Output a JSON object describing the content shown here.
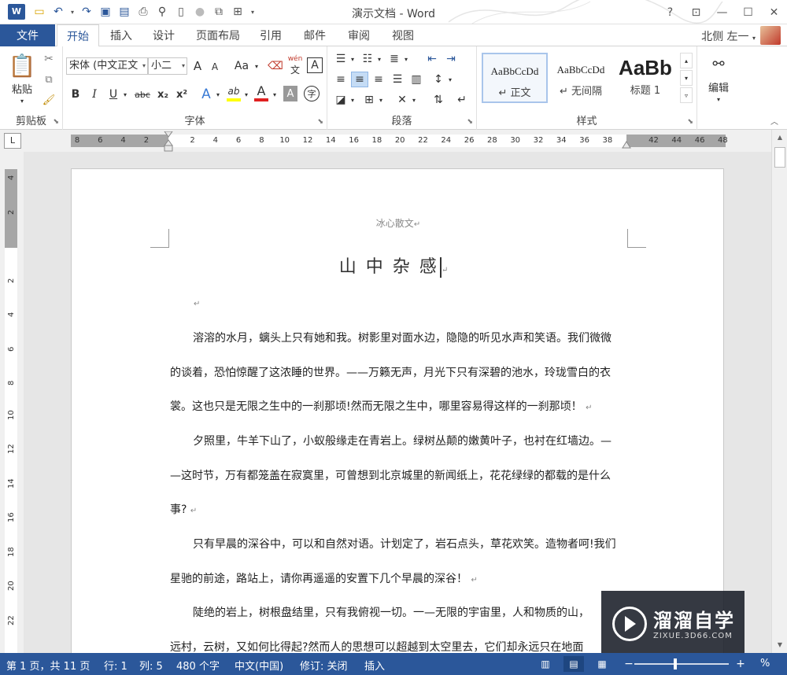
{
  "titlebar": {
    "app_logo": "W",
    "title": "演示文档 - Word",
    "help": "?",
    "qat_icons": [
      "folder-icon",
      "undo-icon",
      "redo-icon",
      "save-icon",
      "save-as-icon",
      "print-preview-icon",
      "find-icon",
      "new-doc-icon",
      "record-icon",
      "format-icon",
      "table-icon"
    ],
    "window_buttons": [
      "?",
      "⊡",
      "—",
      "☐",
      "✕"
    ]
  },
  "tabs": {
    "file": "文件",
    "items": [
      "开始",
      "插入",
      "设计",
      "页面布局",
      "引用",
      "邮件",
      "审阅",
      "视图"
    ],
    "active": "开始",
    "user": "北侧 左一"
  },
  "ribbon": {
    "clipboard": {
      "label": "剪贴板",
      "paste": "粘贴"
    },
    "font": {
      "label": "字体",
      "font_name": "宋体 (中文正文",
      "font_size": "小二",
      "grow": "A",
      "shrink": "A",
      "change_case": "Aa",
      "phonetic_top": "wén",
      "phonetic_bottom": "文",
      "border_char": "A",
      "bold": "B",
      "italic": "I",
      "underline": "U",
      "strike": "abc",
      "subscript": "x₂",
      "superscript": "x²",
      "text_effects": "A",
      "highlight": "ab",
      "font_color": "A",
      "char_shading": "A",
      "enclosed": "字"
    },
    "paragraph": {
      "label": "段落"
    },
    "styles": {
      "label": "样式",
      "items": [
        {
          "sample": "AaBbCcDd",
          "name": "↵ 正文"
        },
        {
          "sample": "AaBbCcDd",
          "name": "↵ 无间隔"
        },
        {
          "sample": "AaBb",
          "name": "标题 1"
        }
      ]
    },
    "editing": {
      "label": "编辑"
    }
  },
  "ruler": {
    "corner": "L",
    "ticks": [
      "8",
      "6",
      "4",
      "2",
      "",
      "2",
      "4",
      "6",
      "8",
      "10",
      "12",
      "14",
      "16",
      "18",
      "20",
      "22",
      "24",
      "26",
      "28",
      "30",
      "32",
      "34",
      "36",
      "38",
      "",
      "42",
      "44",
      "46",
      "48"
    ],
    "vticks": [
      "4",
      "2",
      "",
      "2",
      "4",
      "6",
      "8",
      "10",
      "12",
      "14",
      "16",
      "18",
      "20",
      "22"
    ]
  },
  "document": {
    "header": "冰心散文",
    "title": "山中杂感",
    "lines": [
      "溶溶的水月，螭头上只有她和我。树影里对面水边，隐隐的听见水声和笑语。我们微微",
      "的谈着，恐怕惊醒了这浓睡的世界。——万籁无声，月光下只有深碧的池水，玲珑雪白的衣",
      "裳。这也只是无限之生中的一刹那顷!然而无限之生中，哪里容易得这样的一刹那顷！",
      "夕照里，牛羊下山了，小蚁般缘走在青岩上。绿树丛颠的嫩黄叶子，也衬在红墙边。—",
      "—这时节，万有都笼盖在寂寞里，可曾想到北京城里的新闻纸上，花花绿绿的都载的是什么",
      "事?",
      "只有早晨的深谷中，可以和自然对语。计划定了，岩石点头，草花欢笑。造物者呵!我们",
      "星驰的前途，路站上，请你再遥遥的安置下几个早晨的深谷！",
      "陡绝的岩上，树根盘结里，只有我俯视一切。一—无限的宇宙里，人和物质的山，",
      "远村，云树，又如何比得起?然而人的思想可以超越到太空里去，它们却永远只在地面"
    ]
  },
  "watermark": {
    "cn": "溜溜自学",
    "en": "ZIXUE.3D66.COM"
  },
  "statusbar": {
    "page": "第 1 页，共 11 页",
    "row": "行: 1",
    "col": "列: 5",
    "words": "480 个字",
    "lang": "中文(中国)",
    "revision": "修订: 关闭",
    "mode": "插入",
    "zoom_suffix": "%"
  }
}
